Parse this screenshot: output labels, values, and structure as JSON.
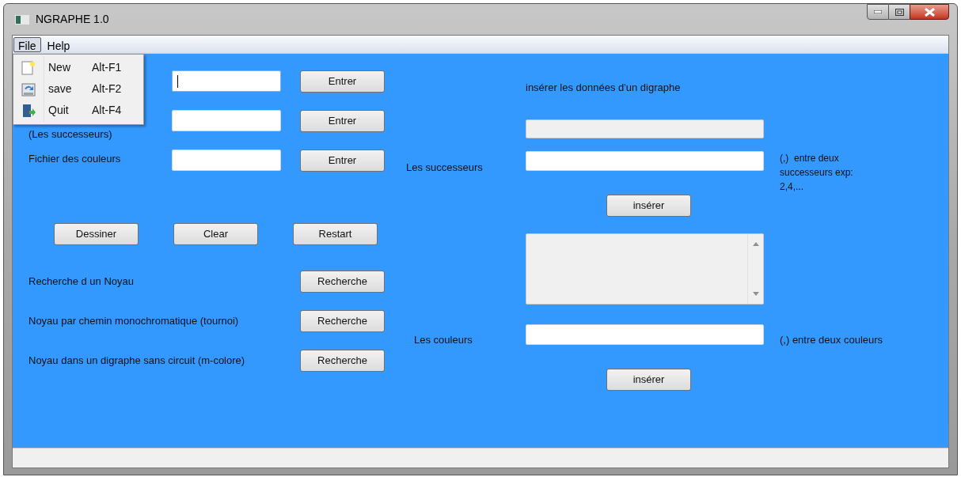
{
  "window": {
    "title": "NGRAPHE 1.0"
  },
  "menu_bar": [
    {
      "label": "File",
      "selected": true
    },
    {
      "label": "Help",
      "selected": false
    }
  ],
  "file_menu": [
    {
      "kind": "new",
      "label": "New",
      "shortcut": "Alt-F1"
    },
    {
      "kind": "save",
      "label": "save",
      "shortcut": "Alt-F2"
    },
    {
      "kind": "quit",
      "label": "Quit",
      "shortcut": "Alt-F4"
    }
  ],
  "file_rows": [
    {
      "button": "Entrer",
      "focused": true
    },
    {
      "label": "(Les successeurs)",
      "button": "Entrer",
      "focused": false
    },
    {
      "label": "Fichier des couleurs",
      "button": "Entrer",
      "focused": false
    }
  ],
  "actions": [
    "Dessiner",
    "Clear",
    "Restart"
  ],
  "searches": [
    {
      "label": "Recherche d un Noyau",
      "button": "Recherche"
    },
    {
      "label": "Noyau par chemin monochromatique (tournoi)",
      "button": "Recherche"
    },
    {
      "label": "Noyau dans un digraphe sans circuit (m-colore)",
      "button": "Recherche"
    }
  ],
  "right_form": {
    "heading": "insérer les données d'un digraphe",
    "display_field": {
      "disabled": true
    },
    "successors_label": "Les successeurs",
    "successors_hint": "(,)  entre deux successeurs exp: 2,4,...",
    "insert_button_1": "insérer",
    "output_area": {
      "disabled": true
    },
    "colors_label": "Les couleurs",
    "colors_hint": "(,) entre deux couleurs",
    "insert_button_2": "insérer"
  }
}
